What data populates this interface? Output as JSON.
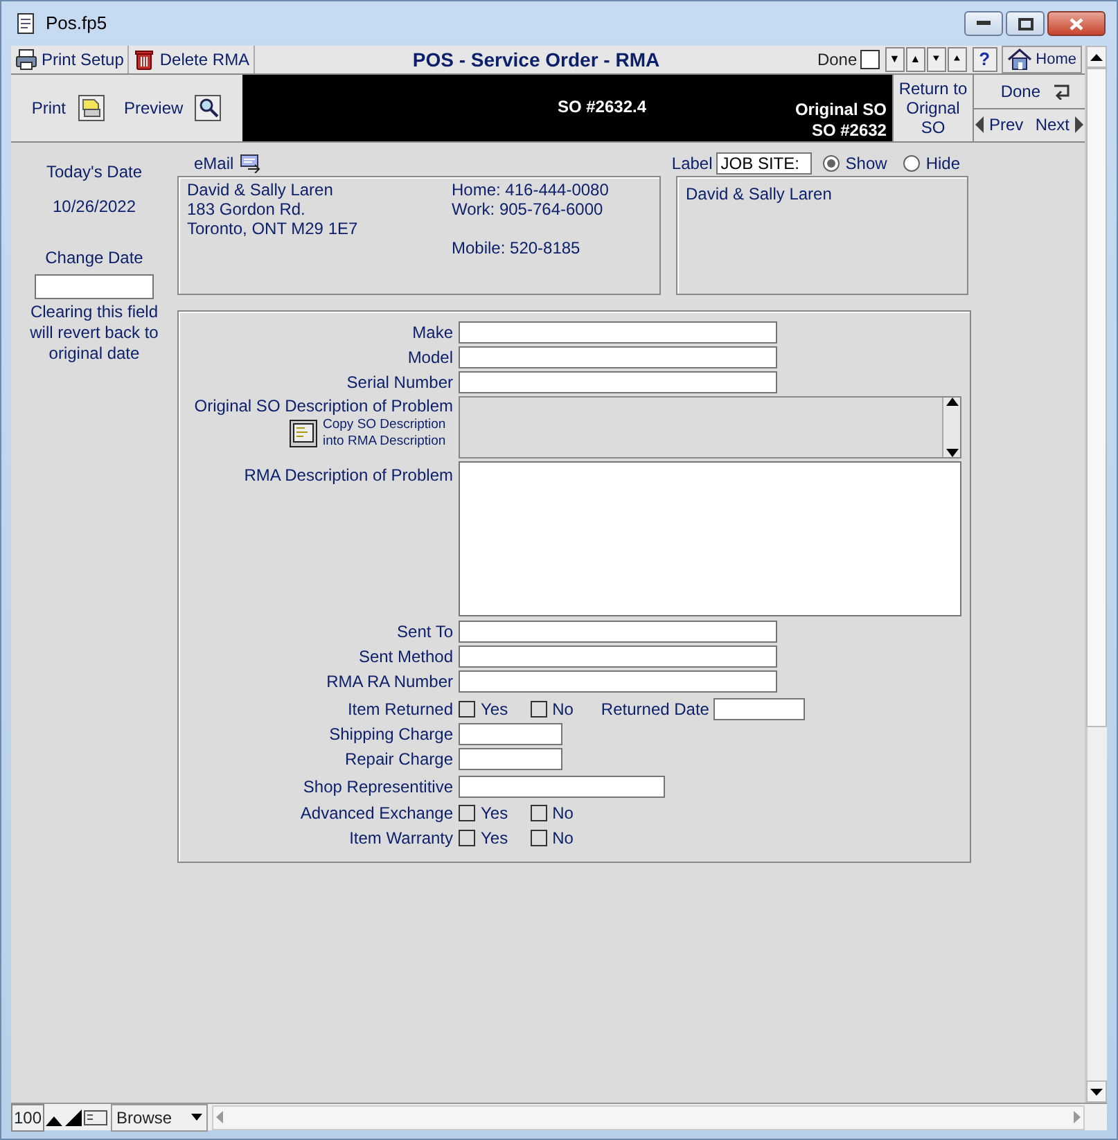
{
  "window": {
    "title": "Pos.fp5"
  },
  "toolbar": {
    "items": [
      {
        "kind": "printer",
        "label": "Print Setup"
      },
      {
        "kind": "trash",
        "label": "Delete RMA"
      }
    ],
    "title": "POS - Service Order - RMA",
    "done": {
      "label": "Done",
      "checked": false
    },
    "nav": [
      "▼",
      "▲",
      "⯆",
      "⯅"
    ],
    "help": "?",
    "home": "Home"
  },
  "header": {
    "print": "Print",
    "preview": "Preview",
    "so_number": "SO #2632.4",
    "original_label": "Original SO",
    "original_number": "SO #2632",
    "return_button": "Return to Orignal SO",
    "done": "Done",
    "prev": "Prev",
    "next": "Next"
  },
  "sidebar": {
    "today_label": "Today's Date",
    "today": "10/26/2022",
    "change_label": "Change Date",
    "hint": "Clearing this field will revert back to original date"
  },
  "contact": {
    "email": "eMail",
    "lines": [
      "David & Sally Laren",
      "183 Gordon Rd.",
      "Toronto, ONT M29 1E7"
    ],
    "phones": [
      "Home: 416-444-0080",
      "Work: 905-764-6000",
      "Mobile: 520-8185"
    ]
  },
  "label_field": {
    "label": "Label",
    "value": "JOB SITE:",
    "options": [
      {
        "label": "Show",
        "selected": true
      },
      {
        "label": "Hide",
        "selected": false
      }
    ],
    "text": "David & Sally Laren"
  },
  "form": [
    {
      "kind": "wide",
      "label": "Make"
    },
    {
      "kind": "wide",
      "label": "Model"
    },
    {
      "kind": "wide",
      "label": "Serial Number"
    },
    {
      "kind": "scroll-memo",
      "label": "Original SO Description of Problem",
      "button": "Copy SO Description into RMA Description"
    },
    {
      "kind": "memo",
      "label": "RMA Description of Problem"
    },
    {
      "kind": "wide",
      "label": "Sent To"
    },
    {
      "kind": "wide",
      "label": "Sent Method"
    },
    {
      "kind": "wide",
      "label": "RMA RA Number"
    },
    {
      "kind": "yesno",
      "label": "Item Returned",
      "yes": {
        "label": "Yes",
        "checked": false
      },
      "no": {
        "label": "No",
        "checked": false
      },
      "date_label": "Returned Date"
    },
    {
      "kind": "short",
      "label": "Shipping Charge"
    },
    {
      "kind": "short",
      "label": "Repair Charge"
    },
    {
      "kind": "medium",
      "label": "Shop Representitive"
    },
    {
      "kind": "yesno",
      "label": "Advanced Exchange",
      "yes": {
        "label": "Yes",
        "checked": false
      },
      "no": {
        "label": "No",
        "checked": false
      }
    },
    {
      "kind": "yesno",
      "label": "Item Warranty",
      "yes": {
        "label": "Yes",
        "checked": false
      },
      "no": {
        "label": "No",
        "checked": false
      }
    }
  ],
  "status_bar": {
    "zoom": "100",
    "mode": "Browse"
  }
}
